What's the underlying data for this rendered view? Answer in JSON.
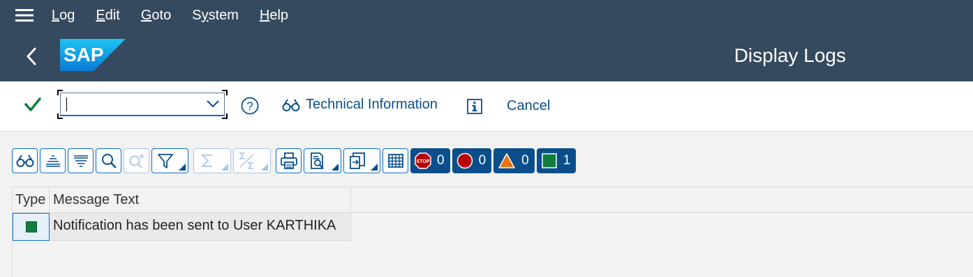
{
  "menu": {
    "items": [
      {
        "first": "L",
        "rest": "og"
      },
      {
        "first": "E",
        "rest": "dit"
      },
      {
        "first": "G",
        "rest": "oto"
      },
      {
        "first": "",
        "rest": "System",
        "ul_index": 1
      },
      {
        "first": "H",
        "rest": "elp"
      }
    ]
  },
  "shell": {
    "logo_text": "SAP",
    "title": "Display Logs"
  },
  "toolbar": {
    "command_value": "",
    "technical_info_label": "Technical Information",
    "cancel_label": "Cancel"
  },
  "status_counts": {
    "error_stop": "0",
    "error": "0",
    "warning": "0",
    "success": "1"
  },
  "grid": {
    "columns": [
      "Type",
      "Message Text"
    ],
    "rows": [
      {
        "type": "success",
        "message": "Notification has been sent to User KARTHIKA"
      }
    ]
  },
  "colors": {
    "shell_bg": "#354a5f",
    "accent": "#0a6ed1",
    "success": "#107e3e",
    "error": "#bb0000",
    "warning": "#e9730c"
  }
}
